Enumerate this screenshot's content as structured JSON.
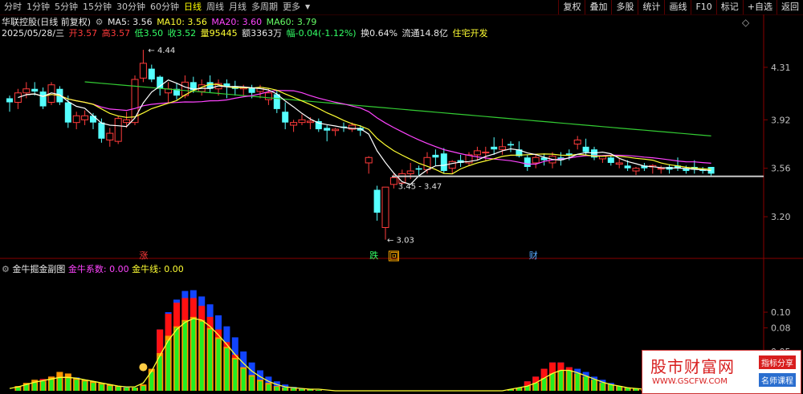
{
  "toolbar": {
    "periods": [
      "分时",
      "1分钟",
      "5分钟",
      "15分钟",
      "30分钟",
      "60分钟",
      "日线",
      "周线",
      "月线",
      "多周期",
      "更多"
    ],
    "active_period": "日线",
    "more_arrow": "▼",
    "buttons": [
      "复权",
      "叠加",
      "多股",
      "统计",
      "画线",
      "F10",
      "标记",
      "+自选",
      "返回"
    ]
  },
  "header": {
    "stock_title": "华联控股(日线 前复权)",
    "ma5": "MA5: 3.56",
    "ma10": "MA10: 3.56",
    "ma20": "MA20: 3.60",
    "ma60": "MA60: 3.79",
    "date": "2025/05/28/三",
    "open": "开3.57",
    "high": "高3.57",
    "low": "低3.50",
    "close": "收3.52",
    "volume": "量95445",
    "amount": "额3363万",
    "change": "幅-0.04(-1.12%)",
    "turnover": "换0.64%",
    "float_cap": "流通14.8亿",
    "sector": "住宅开发",
    "diamond": "◇"
  },
  "indicator": {
    "name": "金牛掘金副图",
    "coef_label": "金牛系数: 0.00",
    "line_label": "金牛线: 0.00"
  },
  "markers": {
    "zhang": "涨",
    "die": "跌",
    "hui": "回",
    "cai": "财",
    "high_label": "4.44",
    "low_label": "3.03",
    "range_label": "3.45 - 3.47"
  },
  "watermark": {
    "title": "股市财富网",
    "url": "WWW.GSCFW.COM",
    "tag1": "指标分享",
    "tag2": "名师课程"
  },
  "colors": {
    "up": "#ff3b3b",
    "down": "#55ffff",
    "ma5": "#ffffff",
    "ma10": "#ffff33",
    "ma20": "#ff44ff",
    "ma60": "#33cc33",
    "bar_orange": "#ff9900",
    "bar_green": "#22ee22",
    "bar_red": "#ff1111",
    "bar_blue": "#1144ff",
    "support": "#c8c8c8"
  },
  "chart_data": [
    {
      "type": "candlestick",
      "y_ticks": [
        4.31,
        3.92,
        3.56,
        3.2
      ],
      "ylim": [
        2.95,
        4.53
      ],
      "support_level": 3.5,
      "candles": [
        [
          4.08,
          4.1,
          3.98,
          4.05
        ],
        [
          4.05,
          4.15,
          4.0,
          4.12
        ],
        [
          4.12,
          4.2,
          4.08,
          4.15
        ],
        [
          4.15,
          4.2,
          4.1,
          4.13
        ],
        [
          4.13,
          4.16,
          4.0,
          4.02
        ],
        [
          4.05,
          4.2,
          4.03,
          4.18
        ],
        [
          4.15,
          4.17,
          4.03,
          4.05
        ],
        [
          4.05,
          4.1,
          3.86,
          3.9
        ],
        [
          3.9,
          3.98,
          3.85,
          3.95
        ],
        [
          3.92,
          3.99,
          3.88,
          3.95
        ],
        [
          3.95,
          3.97,
          3.85,
          3.9
        ],
        [
          3.9,
          3.93,
          3.75,
          3.78
        ],
        [
          3.77,
          3.86,
          3.72,
          3.82
        ],
        [
          3.76,
          3.95,
          3.74,
          3.93
        ],
        [
          3.9,
          3.98,
          3.86,
          3.92
        ],
        [
          3.9,
          4.25,
          3.88,
          4.22
        ],
        [
          4.23,
          4.44,
          4.2,
          4.34
        ],
        [
          4.3,
          4.33,
          4.2,
          4.22
        ],
        [
          4.24,
          4.25,
          4.1,
          4.15
        ],
        [
          4.12,
          4.2,
          4.05,
          4.15
        ],
        [
          4.15,
          4.19,
          4.07,
          4.1
        ],
        [
          4.1,
          4.25,
          4.08,
          4.2
        ],
        [
          4.2,
          4.24,
          4.12,
          4.14
        ],
        [
          4.13,
          4.22,
          4.1,
          4.18
        ],
        [
          4.2,
          4.25,
          4.12,
          4.15
        ],
        [
          4.15,
          4.22,
          4.1,
          4.19
        ],
        [
          4.19,
          4.22,
          4.08,
          4.17
        ],
        [
          4.17,
          4.21,
          4.1,
          4.15
        ],
        [
          4.15,
          4.18,
          4.1,
          4.16
        ],
        [
          4.16,
          4.18,
          4.08,
          4.12
        ],
        [
          4.13,
          4.18,
          4.08,
          4.16
        ],
        [
          4.07,
          4.15,
          4.03,
          4.12
        ],
        [
          4.11,
          4.14,
          3.97,
          4.0
        ],
        [
          3.98,
          4.05,
          3.85,
          3.9
        ],
        [
          3.88,
          3.92,
          3.83,
          3.9
        ],
        [
          3.9,
          3.96,
          3.88,
          3.92
        ],
        [
          3.9,
          3.94,
          3.85,
          3.91
        ],
        [
          3.91,
          3.93,
          3.83,
          3.85
        ],
        [
          3.86,
          3.88,
          3.76,
          3.84
        ],
        [
          3.84,
          3.86,
          3.8,
          3.85
        ],
        [
          3.87,
          3.9,
          3.83,
          3.86
        ],
        [
          3.85,
          3.9,
          3.83,
          3.88
        ],
        [
          3.86,
          3.88,
          3.8,
          3.84
        ],
        [
          3.6,
          3.65,
          3.52,
          3.64
        ],
        [
          3.4,
          3.43,
          3.17,
          3.23
        ],
        [
          3.12,
          3.3,
          3.03,
          3.42
        ],
        [
          3.44,
          3.52,
          3.41,
          3.49
        ],
        [
          3.45,
          3.55,
          3.44,
          3.52
        ],
        [
          3.52,
          3.6,
          3.48,
          3.54
        ],
        [
          3.56,
          3.58,
          3.5,
          3.55
        ],
        [
          3.55,
          3.68,
          3.52,
          3.64
        ],
        [
          3.66,
          3.7,
          3.58,
          3.64
        ],
        [
          3.67,
          3.71,
          3.52,
          3.54
        ],
        [
          3.56,
          3.62,
          3.52,
          3.61
        ],
        [
          3.62,
          3.66,
          3.57,
          3.6
        ],
        [
          3.6,
          3.68,
          3.58,
          3.66
        ],
        [
          3.66,
          3.72,
          3.62,
          3.69
        ],
        [
          3.68,
          3.72,
          3.62,
          3.68
        ],
        [
          3.72,
          3.79,
          3.66,
          3.7
        ],
        [
          3.7,
          3.78,
          3.66,
          3.72
        ],
        [
          3.74,
          3.76,
          3.68,
          3.73
        ],
        [
          3.7,
          3.76,
          3.64,
          3.65
        ],
        [
          3.64,
          3.66,
          3.54,
          3.57
        ],
        [
          3.6,
          3.66,
          3.56,
          3.64
        ],
        [
          3.64,
          3.67,
          3.58,
          3.62
        ],
        [
          3.6,
          3.68,
          3.56,
          3.65
        ],
        [
          3.64,
          3.68,
          3.58,
          3.62
        ],
        [
          3.67,
          3.7,
          3.62,
          3.66
        ],
        [
          3.74,
          3.8,
          3.7,
          3.77
        ],
        [
          3.72,
          3.78,
          3.65,
          3.68
        ],
        [
          3.7,
          3.72,
          3.62,
          3.64
        ],
        [
          3.63,
          3.65,
          3.6,
          3.65
        ],
        [
          3.64,
          3.66,
          3.58,
          3.6
        ],
        [
          3.59,
          3.63,
          3.56,
          3.6
        ],
        [
          3.58,
          3.62,
          3.54,
          3.56
        ],
        [
          3.54,
          3.57,
          3.51,
          3.56
        ],
        [
          3.58,
          3.6,
          3.54,
          3.56
        ],
        [
          3.57,
          3.59,
          3.52,
          3.58
        ],
        [
          3.56,
          3.58,
          3.52,
          3.56
        ],
        [
          3.57,
          3.59,
          3.52,
          3.55
        ],
        [
          3.58,
          3.64,
          3.54,
          3.56
        ],
        [
          3.56,
          3.58,
          3.52,
          3.54
        ],
        [
          3.57,
          3.62,
          3.52,
          3.55
        ],
        [
          3.55,
          3.57,
          3.52,
          3.54
        ],
        [
          3.57,
          3.57,
          3.5,
          3.52
        ]
      ]
    },
    {
      "type": "bar",
      "y_ticks": [
        0.1,
        0.08,
        0.05
      ],
      "ylim": [
        0,
        0.147
      ],
      "orange": [
        0,
        0.006,
        0.01,
        0.014,
        0.012,
        0.018,
        0.024,
        0.022,
        0.016,
        0.014,
        0.012,
        0.01,
        0.008,
        0.006,
        0.004,
        0.004,
        0.008,
        0.028,
        0.048,
        0.07,
        0.082,
        0.09,
        0.094,
        0.09,
        0.08,
        0.068,
        0.056,
        0.042,
        0.03,
        0.02,
        0.014,
        0.01,
        0.006,
        0.004,
        0.003,
        0.002,
        0.002,
        0.001,
        0,
        0,
        0,
        0,
        0,
        0,
        0,
        0,
        0,
        0,
        0,
        0,
        0,
        0,
        0,
        0,
        0,
        0,
        0,
        0,
        0,
        0,
        0.002,
        0.004,
        0.006,
        0.01,
        0.016,
        0.022,
        0.026,
        0.026,
        0.022,
        0.018,
        0.014,
        0.01,
        0.008,
        0.006,
        0.004,
        0.003,
        0.002,
        0.002,
        0.001,
        0.001,
        0,
        0,
        0,
        0,
        0
      ],
      "green": [
        0,
        0.004,
        0.008,
        0.01,
        0.012,
        0.014,
        0.016,
        0.016,
        0.014,
        0.012,
        0.01,
        0.008,
        0.006,
        0.005,
        0.004,
        0.004,
        0.006,
        0.024,
        0.044,
        0.064,
        0.08,
        0.088,
        0.092,
        0.088,
        0.078,
        0.066,
        0.054,
        0.04,
        0.028,
        0.018,
        0.012,
        0.008,
        0.005,
        0.004,
        0.003,
        0.002,
        0.002,
        0.001,
        0,
        0,
        0,
        0,
        0,
        0,
        0,
        0,
        0,
        0,
        0,
        0,
        0,
        0,
        0,
        0,
        0,
        0,
        0,
        0,
        0,
        0,
        0.002,
        0.004,
        0.006,
        0.01,
        0.016,
        0.022,
        0.026,
        0.026,
        0.022,
        0.018,
        0.014,
        0.01,
        0.008,
        0.006,
        0.004,
        0.003,
        0.002,
        0.002,
        0.001,
        0.001,
        0,
        0,
        0,
        0,
        0
      ],
      "red": [
        0,
        0,
        0,
        0,
        0.015,
        0.018,
        0.02,
        0.018,
        0.014,
        0,
        0,
        0,
        0,
        0,
        0,
        0,
        0,
        0,
        0.078,
        0.098,
        0.112,
        0.118,
        0.118,
        0.108,
        0.094,
        0.078,
        0.062,
        0.046,
        0,
        0,
        0,
        0,
        0,
        0,
        0,
        0,
        0,
        0,
        0,
        0,
        0,
        0,
        0,
        0,
        0,
        0,
        0,
        0,
        0,
        0,
        0,
        0,
        0,
        0,
        0,
        0,
        0,
        0,
        0,
        0,
        0,
        0,
        0.012,
        0.018,
        0.028,
        0.036,
        0.036,
        0.03,
        0.022,
        0,
        0,
        0,
        0,
        0,
        0,
        0,
        0,
        0,
        0,
        0,
        0,
        0,
        0,
        0,
        0
      ],
      "blue": [
        0,
        0,
        0,
        0,
        0.015,
        0.018,
        0.021,
        0.02,
        0.017,
        0.014,
        0.012,
        0.01,
        0.008,
        0.006,
        0.005,
        0.004,
        0,
        0,
        0.078,
        0.1,
        0.116,
        0.127,
        0.128,
        0.12,
        0.11,
        0.096,
        0.082,
        0.068,
        0.05,
        0.036,
        0.026,
        0.018,
        0.012,
        0.008,
        0.005,
        0.003,
        0.002,
        0.001,
        0,
        0,
        0,
        0,
        0,
        0,
        0,
        0,
        0,
        0,
        0,
        0,
        0,
        0,
        0,
        0,
        0,
        0,
        0,
        0,
        0,
        0,
        0,
        0,
        0.012,
        0.018,
        0.028,
        0.036,
        0.036,
        0.03,
        0.028,
        0.024,
        0.018,
        0.014,
        0.01,
        0.006,
        0.004,
        0.003,
        0.002,
        0.002,
        0.001,
        0.001,
        0,
        0,
        0,
        0,
        0
      ],
      "yellow_line": [
        0.003,
        0.005,
        0.008,
        0.011,
        0.013,
        0.015,
        0.017,
        0.017,
        0.016,
        0.014,
        0.012,
        0.01,
        0.008,
        0.006,
        0.005,
        0.005,
        0.01,
        0.025,
        0.045,
        0.064,
        0.078,
        0.087,
        0.092,
        0.09,
        0.082,
        0.071,
        0.059,
        0.046,
        0.035,
        0.025,
        0.018,
        0.012,
        0.008,
        0.005,
        0.004,
        0.003,
        0.002,
        0.002,
        0.001,
        0,
        0,
        0,
        0,
        0,
        0,
        0,
        0,
        0,
        0,
        0,
        0,
        0,
        0,
        0,
        0,
        0,
        0,
        0,
        0,
        0,
        0.002,
        0.004,
        0.006,
        0.01,
        0.016,
        0.022,
        0.026,
        0.026,
        0.023,
        0.019,
        0.015,
        0.011,
        0.008,
        0.006,
        0.004,
        0.003,
        0.002,
        0.002,
        0.001,
        0.001,
        0,
        0,
        0,
        0,
        0
      ]
    }
  ]
}
